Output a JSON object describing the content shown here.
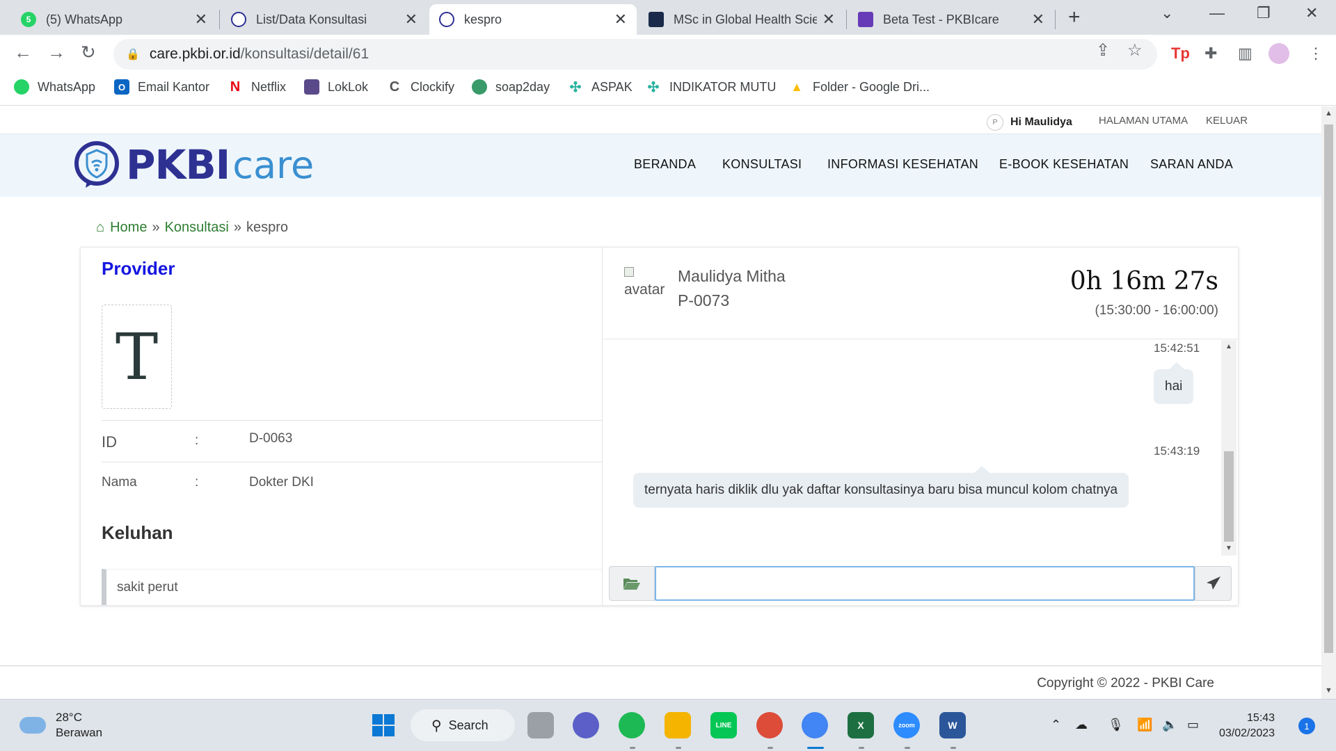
{
  "browser": {
    "tabs": [
      {
        "title": "(5) WhatsApp",
        "fav_text": "5",
        "fav_color": "#25d366"
      },
      {
        "title": "List/Data Konsultasi",
        "fav_text": "",
        "fav_color": "#2e3192"
      },
      {
        "title": "kespro",
        "fav_text": "",
        "fav_color": "#2e3192"
      },
      {
        "title": "MSc in Global Health Scie",
        "fav_text": "",
        "fav_color": "#1a2a4a"
      },
      {
        "title": "Beta Test - PKBIcare",
        "fav_text": "",
        "fav_color": "#673ab7"
      }
    ],
    "active_tab": 2,
    "url_host": "care.pkbi.or.id",
    "url_path": "/konsultasi/detail/61",
    "bookmarks": [
      {
        "label": "WhatsApp",
        "color": "#25d366"
      },
      {
        "label": "Email Kantor",
        "color": "#0a66c2"
      },
      {
        "label": "Netflix",
        "color": "#e50914"
      },
      {
        "label": "LokLok",
        "color": "#5a4a8a"
      },
      {
        "label": "Clockify",
        "color": "#555555"
      },
      {
        "label": "soap2day",
        "color": "#3a9a6a"
      },
      {
        "label": "ASPAK",
        "color": "#2bb3a0"
      },
      {
        "label": "INDIKATOR MUTU",
        "color": "#2bb3a0"
      },
      {
        "label": "Folder - Google Dri...",
        "color": "#fbbc04"
      }
    ]
  },
  "site": {
    "greeting": "Hi Maulidya",
    "top_links": [
      "HALAMAN UTAMA",
      "KELUAR"
    ],
    "logo_bold": "PKBI",
    "logo_light": "care",
    "nav": [
      "BERANDA",
      "KONSULTASI",
      "INFORMASI KESEHATAN",
      "E-BOOK KESEHATAN",
      "SARAN ANDA"
    ],
    "breadcrumb": [
      "Home",
      "Konsultasi",
      "kespro"
    ],
    "breadcrumb_sep": "»"
  },
  "provider": {
    "title": "Provider",
    "photo_letter": "T",
    "fields": [
      {
        "label": "ID",
        "colon": ":",
        "value": "D-0063"
      },
      {
        "label": "Nama",
        "colon": ":",
        "value": "Dokter DKI"
      }
    ],
    "keluhan_title": "Keluhan",
    "keluhan_text": "sakit perut"
  },
  "chat": {
    "avatar_alt": "avatar",
    "patient_name": "Maulidya Mitha",
    "patient_id": "P-0073",
    "timer": "0h 16m 27s",
    "time_range": "(15:30:00 - 16:00:00)",
    "messages": [
      {
        "time": "15:42:51",
        "text": "hai"
      },
      {
        "time": "15:43:19",
        "text": "ternyata haris diklik dlu yak daftar konsultasinya baru bisa muncul kolom chatnya"
      }
    ],
    "input_value": ""
  },
  "footer": {
    "copyright": "Copyright © 2022 - PKBI Care"
  },
  "taskbar": {
    "temp": "28°C",
    "weather": "Berawan",
    "search_label": "Search",
    "time": "15:43",
    "date": "03/02/2023",
    "notifications": "1"
  }
}
